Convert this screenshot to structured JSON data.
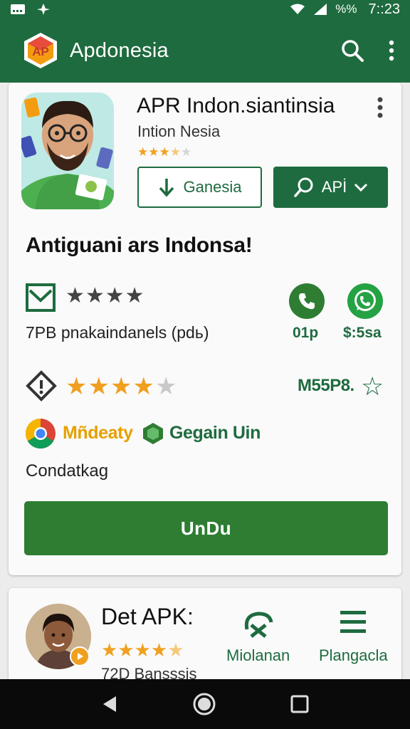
{
  "status_bar": {
    "battery": "%",
    "signal_text": "%%",
    "time": "7::23"
  },
  "app_bar": {
    "title": "Apdonesia",
    "logo_text": "AP"
  },
  "app": {
    "name": "APR Indon.siantinsia",
    "publisher": "Intion Nesia",
    "small_stars": "★★★★★",
    "install_label": "Ganesia",
    "api_label": "AΡİ"
  },
  "headline": "Antiguani ars Indonsa!",
  "rating_row": {
    "stars": "★★★★",
    "meta": "7PB  pnakaindanels (pdь)",
    "call_label": "01p",
    "whatsapp_label": "$:5sa"
  },
  "price_row": {
    "stars": "★★★★★",
    "price": "M55P8.",
    "star_outline": "☆"
  },
  "tags": {
    "chrome_label": "Mñdeaty",
    "gem_label": "Gegain Uin"
  },
  "footnote": "Condatkag",
  "download_button": "UnDu",
  "second_card": {
    "title": "Det APK:",
    "stars": "★★★★★",
    "subtitle": "72D Bansssis",
    "action1": "Miolanan",
    "action2": "Plangacla"
  },
  "colors": {
    "primary": "#1e6b3f",
    "button": "#2e7d32",
    "star_gold": "#f0a020"
  }
}
